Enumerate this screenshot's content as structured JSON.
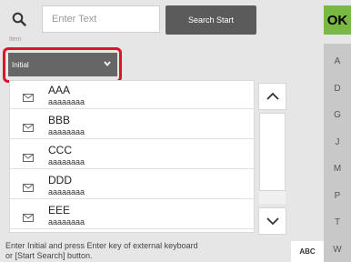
{
  "search": {
    "icon": "search-icon",
    "placeholder": "Enter Text",
    "start_label": "Search Start"
  },
  "ok_label": "OK",
  "item_label": "Item",
  "select": {
    "value": "Initial"
  },
  "list": {
    "items": [
      {
        "name": "AAA",
        "sub": "aaaaaaaa",
        "icon": "mail-icon"
      },
      {
        "name": "BBB",
        "sub": "aaaaaaaa",
        "icon": "mail-icon"
      },
      {
        "name": "CCC",
        "sub": "aaaaaaaa",
        "icon": "mail-icon"
      },
      {
        "name": "DDD",
        "sub": "aaaaaaaa",
        "icon": "mail-icon"
      },
      {
        "name": "EEE",
        "sub": "aaaaaaaa",
        "icon": "mail-icon"
      }
    ]
  },
  "index_letters": [
    "A",
    "D",
    "G",
    "J",
    "M",
    "P",
    "T",
    "W"
  ],
  "footer": {
    "line1": "Enter Initial and press Enter key of external keyboard",
    "line2": "or [Start Search] button."
  },
  "abc_label": "ABC",
  "colors": {
    "ok": "#78b843",
    "highlight": "#d8152e",
    "dark_button": "#5b5b5b"
  }
}
